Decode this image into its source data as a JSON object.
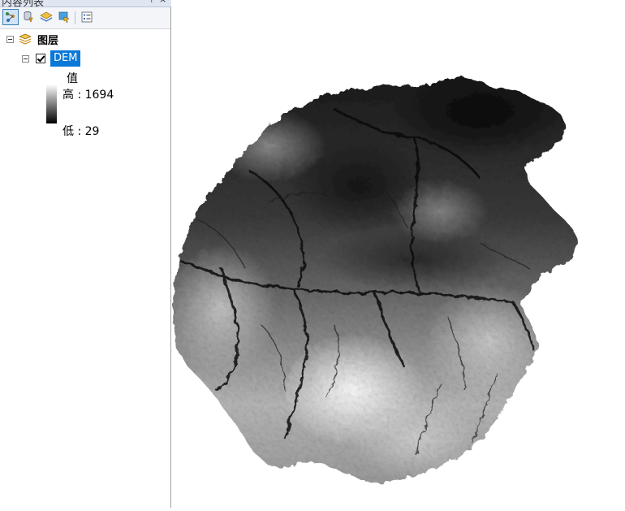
{
  "toc": {
    "title": "内容列表",
    "toolbar": {
      "buttons": [
        {
          "icon": "list-by-drawing-order-icon",
          "active": true
        },
        {
          "icon": "list-by-source-icon",
          "active": false
        },
        {
          "icon": "list-by-visibility-icon",
          "active": false
        },
        {
          "icon": "list-by-selection-icon",
          "active": false
        },
        {
          "icon": "options-icon",
          "active": false
        }
      ]
    },
    "layers_group": {
      "label": "图层"
    },
    "layer": {
      "name": "DEM",
      "checked": true,
      "legend": {
        "field": "值",
        "high_label": "高 : 1694",
        "low_label": "低 : 29"
      }
    }
  },
  "map": {
    "layer": "DEM",
    "render": "grayscale-stretched",
    "high_value": 1694,
    "low_value": 29,
    "colors": {
      "low": "#000000",
      "high": "#ffffff"
    }
  },
  "colors": {
    "selection": "#0a78d7",
    "panel_border": "#a0a0a0",
    "titlebar": "#dfe6f2"
  }
}
